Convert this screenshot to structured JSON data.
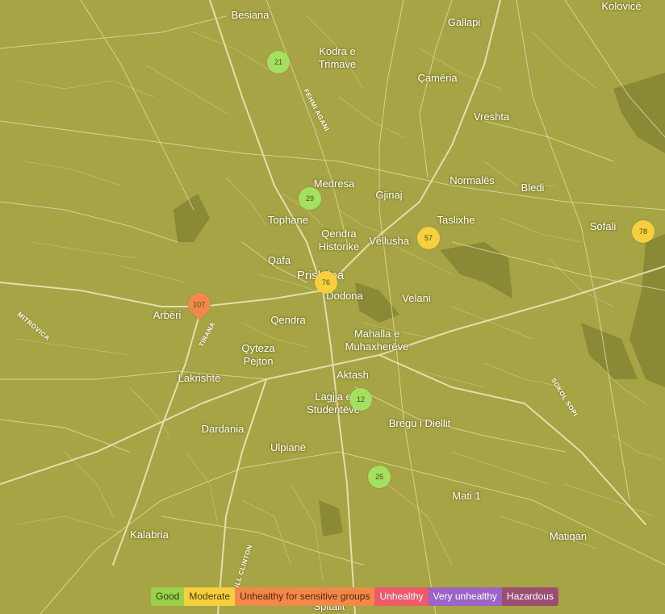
{
  "places": {
    "kolovice": "Kolovicë",
    "besiana": "Besiana",
    "gallapi": "Gallapi",
    "kodra": "Kodra e\nTrimave",
    "camera": "Çamëria",
    "vreshta": "Vreshta",
    "medresa": "Medresa",
    "normales": "Normalës",
    "bledi": "Bledi",
    "gjinaj": "Gjinaj",
    "tophane": "Tophane",
    "taslixhe": "Taslixhe",
    "sofali": "Sofali",
    "qendra_historike": "Qendra\nHistorike",
    "vellusha": "Vëllusha",
    "qafa": "Qafa",
    "prishtina": "Prishtina",
    "dodona": "Dodona",
    "velani": "Velani",
    "arberi": "Arbëri",
    "qendra": "Qendra",
    "mahalla": "Mahalla e\nMuhaxherëve",
    "qyteza": "Qyteza\nPejton",
    "aktash": "Aktash",
    "lakrishte": "Lakrishtë",
    "lagjja": "Lagjja e\nStudentëve",
    "bregu": "Bregu i Diellit",
    "dardania": "Dardania",
    "ulpiane": "Ulpianë",
    "mati": "Mati 1",
    "kalabria": "Kalabria",
    "matiqan": "Matiqan",
    "spitalit": "Spitalit"
  },
  "roads": {
    "fehmi": "FEHMI AGANI",
    "mitrovica": "MITROVICA",
    "tirana": "TIRANA",
    "sokol": "SOKOL SOPI",
    "bill": "BILL CLINTON"
  },
  "markers": [
    {
      "id": "marker-21",
      "value": "21",
      "color": "#a3e060",
      "pin": false
    },
    {
      "id": "marker-29",
      "value": "29",
      "color": "#a3e060",
      "pin": false
    },
    {
      "id": "marker-57",
      "value": "57",
      "color": "#f6cf3e",
      "pin": false
    },
    {
      "id": "marker-78",
      "value": "78",
      "color": "#f6cf3e",
      "pin": false
    },
    {
      "id": "marker-76",
      "value": "76",
      "color": "#f6cf3e",
      "pin": false
    },
    {
      "id": "marker-107",
      "value": "107",
      "color": "#f2894a",
      "pin": true
    },
    {
      "id": "marker-12",
      "value": "12",
      "color": "#a3e060",
      "pin": false
    },
    {
      "id": "marker-25",
      "value": "25",
      "color": "#a3e060",
      "pin": false
    }
  ],
  "legend": [
    {
      "label": "Good",
      "bg": "#9ad04c",
      "fg": "#2d4010"
    },
    {
      "label": "Moderate",
      "bg": "#f6cf3e",
      "fg": "#4a3c08"
    },
    {
      "label": "Unhealthy for sensitive groups",
      "bg": "#f2894a",
      "fg": "#5a2608"
    },
    {
      "label": "Unhealthy",
      "bg": "#ef5a6a",
      "fg": "#ffffff"
    },
    {
      "label": "Very unhealthy",
      "bg": "#9c63c8",
      "fg": "#ffffff"
    },
    {
      "label": "Hazardous",
      "bg": "#9a4f70",
      "fg": "#ffffff"
    }
  ],
  "colors": {
    "land": "#a6a444",
    "street": "#e8e6b8",
    "park": "#8a8a36"
  }
}
